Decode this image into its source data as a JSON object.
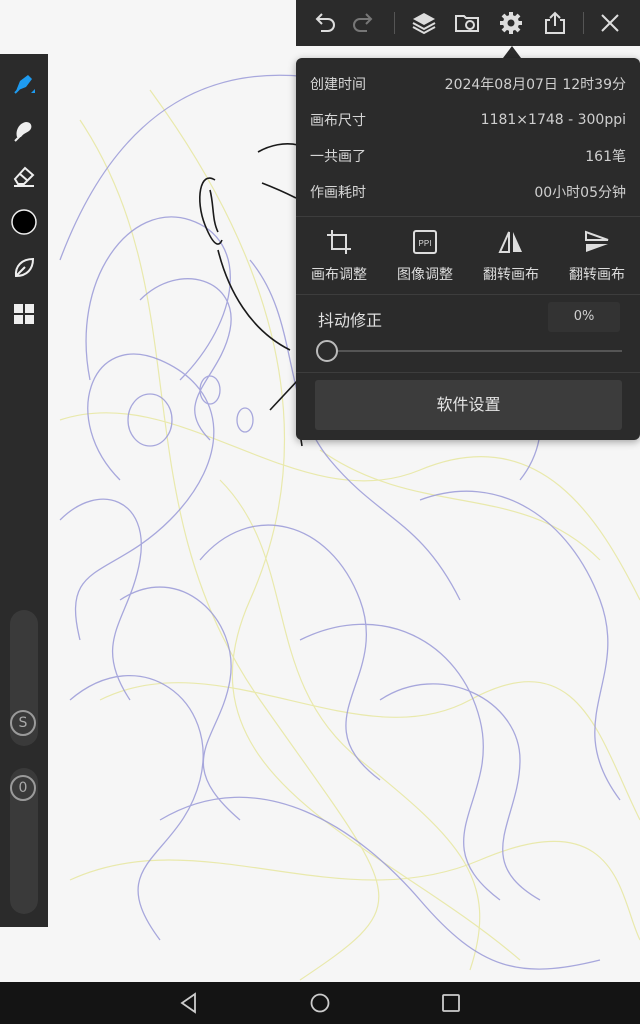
{
  "canvas": {
    "background": "#f6f6f6",
    "sketch_colors": [
      "#8e8ed8",
      "#e8e8a0",
      "#1a1a1a"
    ]
  },
  "left_tools": [
    {
      "name": "brush-tool-icon",
      "active": true,
      "accent": "#1e9bf0"
    },
    {
      "name": "smudge-tool-icon"
    },
    {
      "name": "eraser-tool-icon"
    },
    {
      "name": "color-swatch",
      "color": "#000000"
    },
    {
      "name": "leaf-tool-icon"
    },
    {
      "name": "grid-tool-icon"
    }
  ],
  "sliders": {
    "size_badge": "S",
    "opacity_badge": "0"
  },
  "toolbar": {
    "icons": [
      "undo-icon",
      "redo-icon",
      "layers-icon",
      "folder-sync-icon",
      "gear-icon",
      "share-icon",
      "close-icon"
    ]
  },
  "panel": {
    "info": [
      {
        "label": "创建时间",
        "value": "2024年08月07日 12时39分"
      },
      {
        "label": "画布尺寸",
        "value": "1181×1748 - 300ppi"
      },
      {
        "label": "一共画了",
        "value": "161笔"
      },
      {
        "label": "作画耗时",
        "value": "00小时05分钟"
      }
    ],
    "actions": [
      {
        "icon": "crop-icon",
        "label": "画布调整"
      },
      {
        "icon": "ppi-icon",
        "label": "图像调整",
        "icon_text": "PPI"
      },
      {
        "icon": "flip-horizontal-icon",
        "label": "翻转画布"
      },
      {
        "icon": "flip-vertical-icon",
        "label": "翻转画布"
      }
    ],
    "stabilization": {
      "label": "抖动修正",
      "value": "0%",
      "level": 0
    },
    "settings_button": "软件设置"
  },
  "navbar": {
    "icons": [
      "back-icon",
      "home-icon",
      "recents-icon"
    ]
  }
}
